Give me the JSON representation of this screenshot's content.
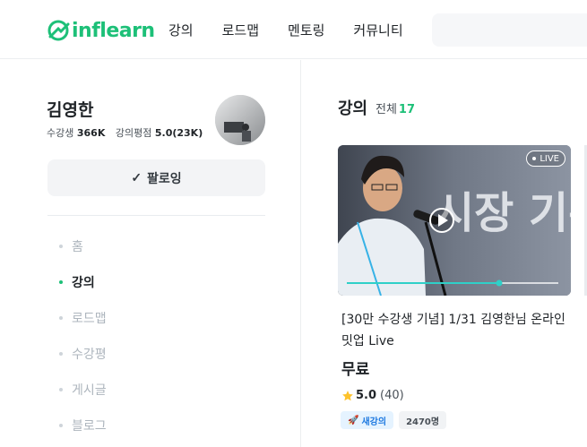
{
  "header": {
    "logo_text": "inflearn",
    "nav": [
      "강의",
      "로드맵",
      "멘토링",
      "커뮤니티"
    ],
    "brand_color": "#1dc078"
  },
  "profile": {
    "name": "김영한",
    "students_label": "수강생",
    "students_value": "366K",
    "rating_label": "강의평점",
    "rating_value": "5.0(23K)",
    "follow_label": "팔로잉"
  },
  "side_menu": [
    {
      "label": "홈",
      "active": false
    },
    {
      "label": "강의",
      "active": true
    },
    {
      "label": "로드맵",
      "active": false
    },
    {
      "label": "수강평",
      "active": false
    },
    {
      "label": "게시글",
      "active": false
    },
    {
      "label": "블로그",
      "active": false
    }
  ],
  "courses": {
    "heading": "강의",
    "total_label": "전체",
    "total_count": "17",
    "card": {
      "live_label": "LIVE",
      "thumb_text": "시장 기본기",
      "title": "[30만 수강생 기념] 1/31 김영한님 온라인 밋업 Live",
      "price": "무료",
      "rating": "5.0",
      "rating_count": "(40)",
      "tag_new": "새강의",
      "tag_students": "2470명"
    }
  }
}
